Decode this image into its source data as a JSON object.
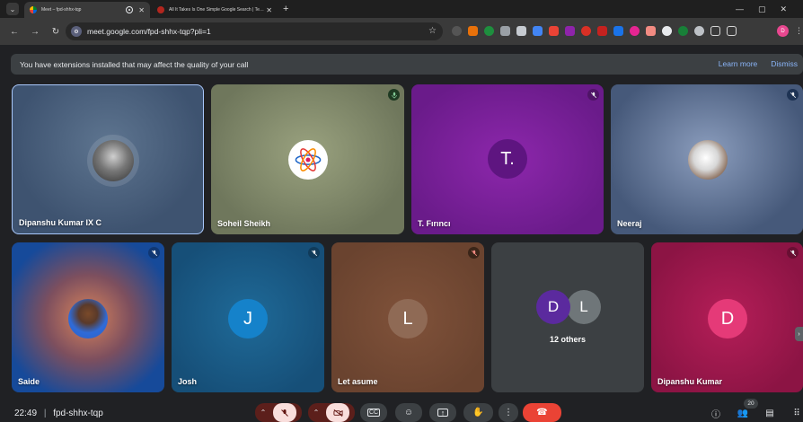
{
  "browser": {
    "tabs": [
      {
        "title": "Meet – fpd-shhx-tqp",
        "active": true
      },
      {
        "title": "All It Takes Is One Simple Google Search | Tech...",
        "active": false
      }
    ],
    "url": "meet.google.com/fpd-shhx-tqp?pli=1"
  },
  "banner": {
    "message": "You have extensions installed that may affect the quality of your call",
    "learn_more": "Learn more",
    "dismiss": "Dismiss"
  },
  "participants": [
    {
      "name": "Dipanshu Kumar IX C"
    },
    {
      "name": "Soheil Sheikh"
    },
    {
      "name": "T. Fırıncı",
      "initial": "T."
    },
    {
      "name": "Neeraj"
    },
    {
      "name": "Saide"
    },
    {
      "name": "Josh",
      "initial": "J"
    },
    {
      "name": "Let asume",
      "initial": "L"
    },
    {
      "name": "others",
      "others_label": "12 others",
      "initials": [
        "D",
        "L"
      ]
    },
    {
      "name": "Dipanshu Kumar",
      "initial": "D"
    }
  ],
  "bottom": {
    "time": "22:49",
    "meeting_code": "fpd-shhx-tqp",
    "people_count": "20"
  },
  "colors": {
    "accent": "#8ab4f8",
    "end_call": "#ea4335",
    "mic_off": "#ea4335"
  }
}
